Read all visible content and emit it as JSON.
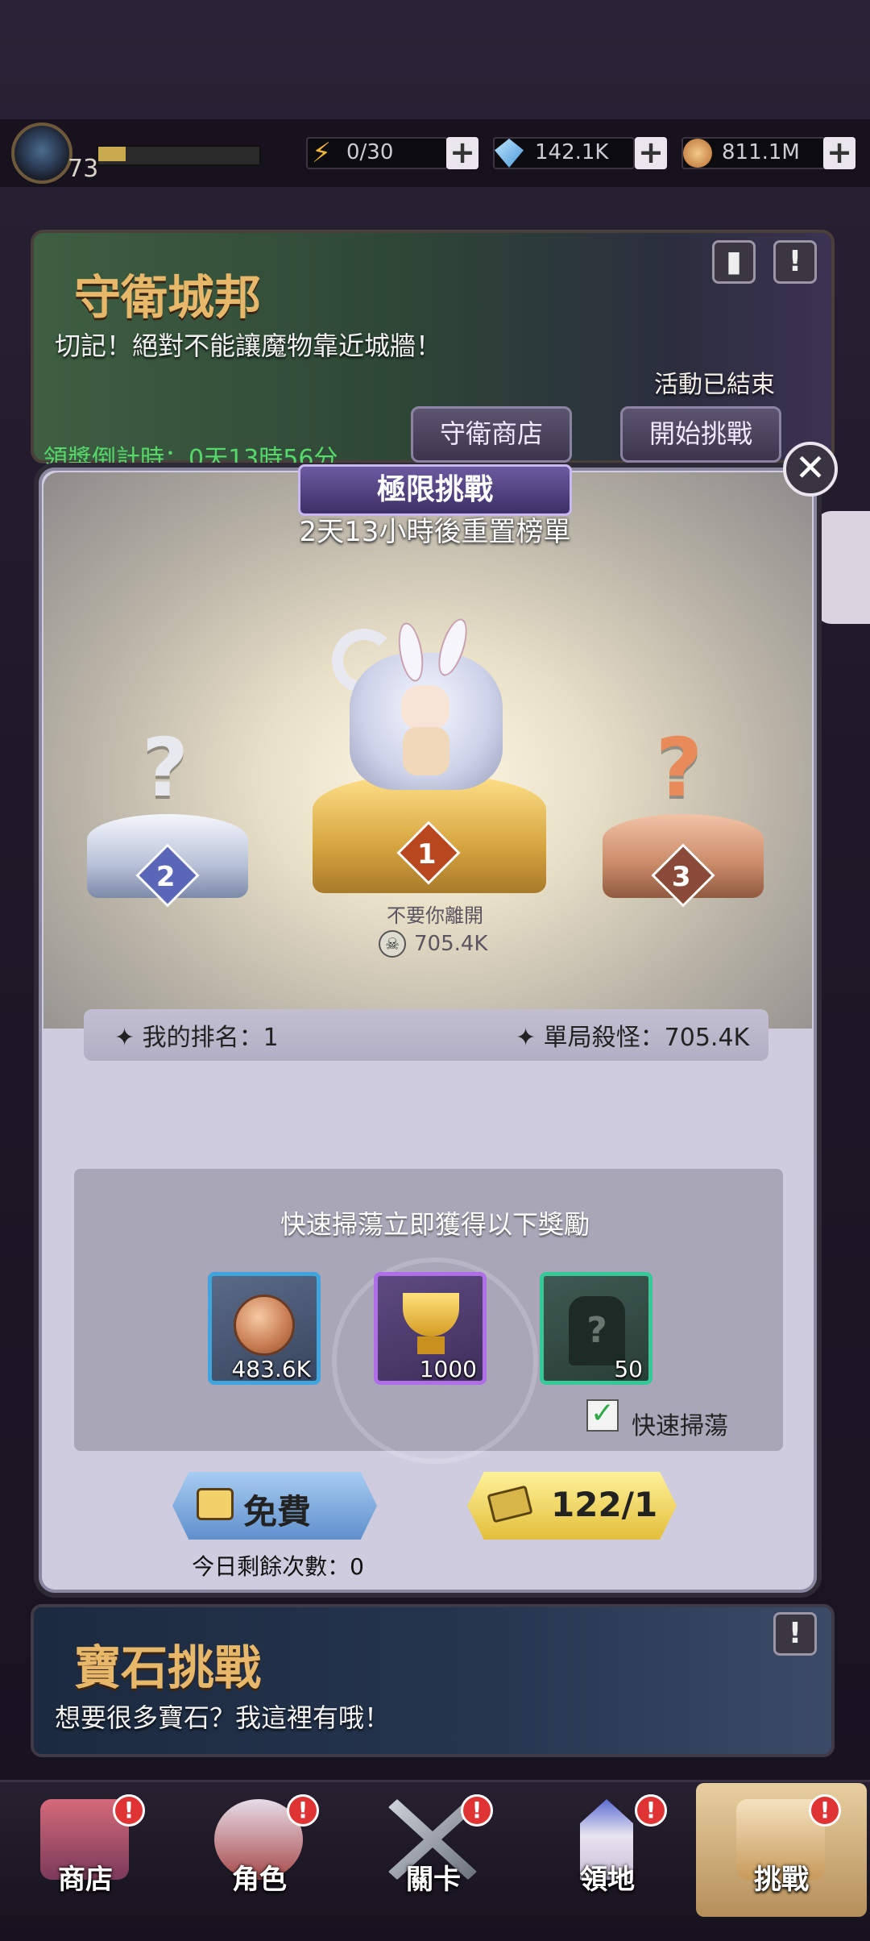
{
  "header": {
    "level": "73",
    "energy": "0/30",
    "gems": "142.1K",
    "gold": "811.1M",
    "plus": "+"
  },
  "event_banner": {
    "title": "守衛城邦",
    "subtitle": "切記！絕對不能讓魔物靠近城牆！",
    "status": "活動已結束",
    "countdown": "領獎倒計時：0天13時56分",
    "shop_label": "守衛商店",
    "start_label": "開始挑戰"
  },
  "modal": {
    "title": "極限挑戰",
    "reset_text": "2天13小時後重置榜單",
    "close_glyph": "✕",
    "podium": {
      "first_rank": "1",
      "second_rank": "2",
      "third_rank": "3",
      "unknown_glyph": "?",
      "first_player_name": "不要你離開",
      "first_player_score": "705.4K"
    },
    "my_rank": "✦ 我的排名：1",
    "best_kills": "✦ 單局殺怪：705.4K",
    "reward_title": "快速掃蕩立即獲得以下獎勵",
    "rewards": [
      {
        "name": "gold-coin",
        "count": "483.6K"
      },
      {
        "name": "trophy",
        "count": "1000"
      },
      {
        "name": "mystery-costume",
        "count": "50"
      }
    ],
    "quick_sweep_label": "快速掃蕩",
    "quick_sweep_checked": true,
    "free_button": "免費",
    "remaining_today": "今日剩餘次數：0",
    "ticket_button": "122/1"
  },
  "gem_banner": {
    "title": "寶石挑戰",
    "subtitle": "想要很多寶石？我這裡有哦！"
  },
  "nav": {
    "items": [
      {
        "label": "商店",
        "active": false
      },
      {
        "label": "角色",
        "active": false
      },
      {
        "label": "關卡",
        "active": false
      },
      {
        "label": "領地",
        "active": false
      },
      {
        "label": "挑戰",
        "active": true
      }
    ],
    "badge_glyph": "!"
  },
  "colors": {
    "banner_title": "#e7b86a",
    "countdown_green": "#56d86a",
    "modal_bg": "#cfcce0",
    "gold_podium": "#d6a640",
    "silver_podium": "#b8c2d8",
    "bronze_podium": "#c98a68",
    "free_button": "#5f8fcc",
    "ticket_button": "#e3bf3a",
    "badge_red": "#e03434"
  }
}
